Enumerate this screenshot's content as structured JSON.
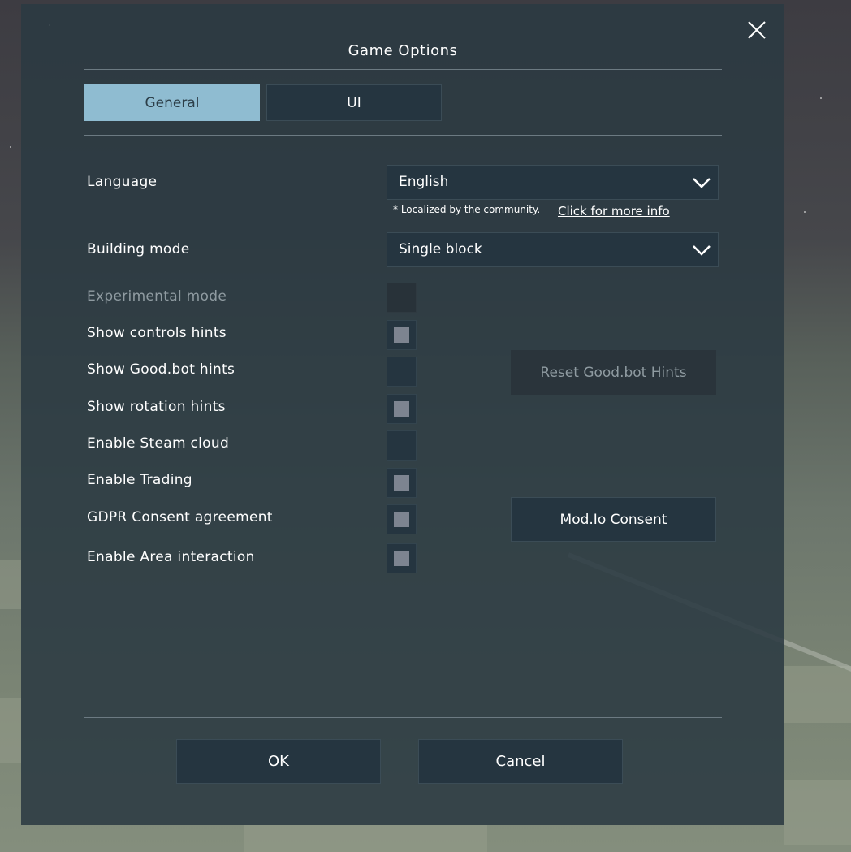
{
  "dialog": {
    "title": "Game Options",
    "close_icon": "close-icon"
  },
  "tabs": [
    {
      "label": "General",
      "active": true
    },
    {
      "label": "UI",
      "active": false
    }
  ],
  "language": {
    "label": "Language",
    "value": "English",
    "note": "* Localized by the community.",
    "link": "Click for more info"
  },
  "building_mode": {
    "label": "Building mode",
    "value": "Single block"
  },
  "options": [
    {
      "label": "Experimental mode",
      "checked": false,
      "disabled": true
    },
    {
      "label": "Show controls hints",
      "checked": true,
      "disabled": false
    },
    {
      "label": "Show Good.bot hints",
      "checked": false,
      "disabled": false
    },
    {
      "label": "Show rotation hints",
      "checked": true,
      "disabled": false
    },
    {
      "label": "Enable Steam cloud",
      "checked": false,
      "disabled": false
    },
    {
      "label": "Enable Trading",
      "checked": true,
      "disabled": false
    },
    {
      "label": "GDPR Consent agreement",
      "checked": true,
      "disabled": false
    },
    {
      "label": "Enable Area interaction",
      "checked": true,
      "disabled": false
    }
  ],
  "buttons": {
    "reset_goodbot": "Reset Good.bot Hints",
    "modio_consent": "Mod.Io Consent",
    "ok": "OK",
    "cancel": "Cancel"
  },
  "colors": {
    "panel_bg": "#2b3a42",
    "tab_active": "#8fbcd1",
    "control_bg": "#253540",
    "checkbox_mark": "#7d8490",
    "disabled_text": "#8f9ba1"
  }
}
